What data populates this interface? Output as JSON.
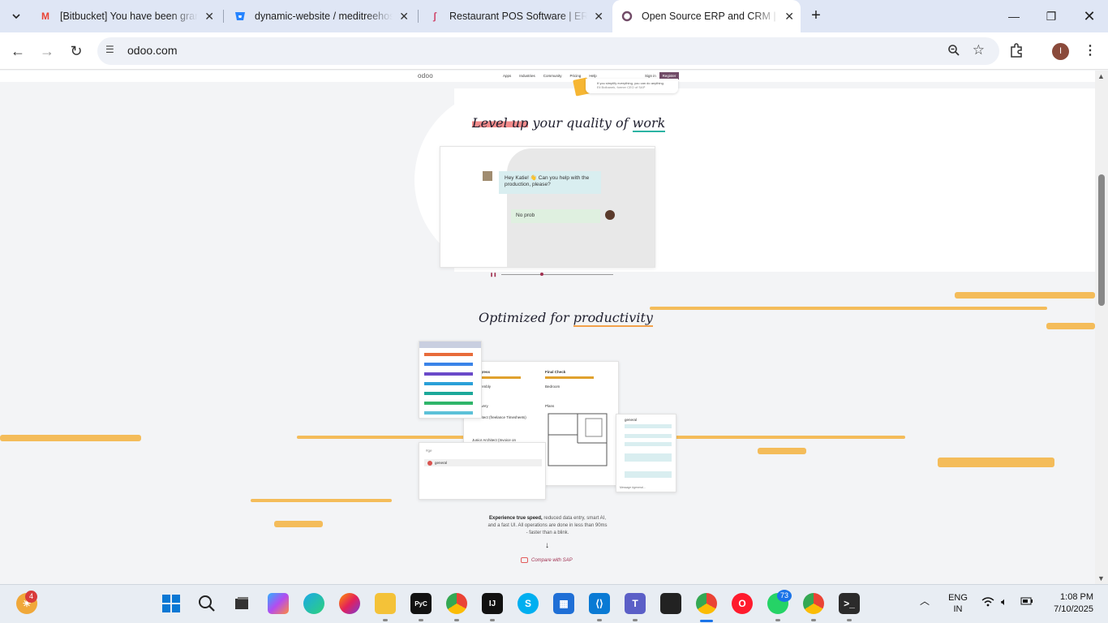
{
  "browser": {
    "tabs": [
      {
        "title": "[Bitbucket] You have been gran",
        "favicon": "gmail-icon",
        "active": false
      },
      {
        "title": "dynamic-website / meditreehos",
        "favicon": "bitbucket-icon",
        "active": false
      },
      {
        "title": "Restaurant POS Software | ERP",
        "favicon": "pos-icon",
        "active": false
      },
      {
        "title": "Open Source ERP and CRM | Od",
        "favicon": "odoo-icon",
        "active": true
      }
    ],
    "url": "odoo.com",
    "profile_initial": "I"
  },
  "site_nav": {
    "logo": "odoo",
    "links": [
      "Apps",
      "Industries",
      "Community",
      "Pricing",
      "Help"
    ],
    "sign_in": "Sign in",
    "register": "Register"
  },
  "testimonial": {
    "quote": "If you simplify everything, you can do anything.",
    "author": "Eli Bolbanek, former CEO of SAP"
  },
  "section1": {
    "heading_highlight": "Level up",
    "heading_mid": " your quality of ",
    "heading_underline": "work",
    "chat_msg_1": "Hey Katie! 👋 Can you help with the production, please?",
    "chat_msg_2": "No prob"
  },
  "section2": {
    "heading_pre": "Optimized for ",
    "heading_underline": "productivity",
    "desc_bold": "Experience true speed,",
    "desc_rest": " reduced data entry, smart AI, and a fast UI. All operations are done in less than 90ms - faster than a blink.",
    "compare_link": "Compare with SAP",
    "mini_search_placeholder": "#ge",
    "mini_channel": "general",
    "mini_kanban_col1": "gress",
    "mini_kanban_col2": "Final Check",
    "mini_kanban_item1": "e Assembly",
    "mini_kanban_item2": "y Delivery",
    "mini_kanban_item3": "t Architect (freelance Timesheets)",
    "mini_kanban_item4": "Junior Architect (Invoice on",
    "mini_kanban_bedroom": "Bedroom",
    "mini_kanban_plans": "Plans",
    "mini_chat_channel": "general",
    "mini_chat_footer": "Message #general..."
  },
  "taskbar": {
    "weather_badge": "4",
    "chrome_badge": "",
    "whatsapp_badge": "73",
    "lang": "ENG",
    "region": "IN",
    "time": "1:08 PM",
    "date": "7/10/2025"
  }
}
